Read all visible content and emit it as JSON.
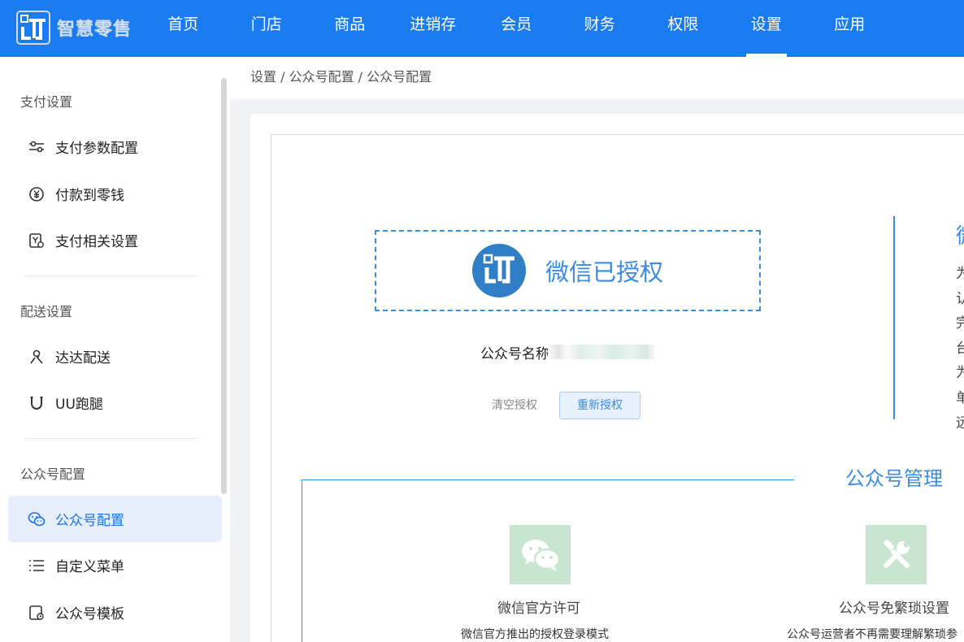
{
  "brand": {
    "name": "智慧零售"
  },
  "nav": {
    "items": [
      "首页",
      "门店",
      "商品",
      "进销存",
      "会员",
      "财务",
      "权限",
      "设置",
      "应用"
    ],
    "active_index": 7
  },
  "sidebar": {
    "groups": [
      {
        "title": "支付设置",
        "items": [
          "支付参数配置",
          "付款到零钱",
          "支付相关设置"
        ]
      },
      {
        "title": "配送设置",
        "items": [
          "达达配送",
          "UU跑腿"
        ]
      },
      {
        "title": "公众号配置",
        "items": [
          "公众号配置",
          "自定义菜单",
          "公众号模板"
        ]
      }
    ],
    "active_item": "公众号配置"
  },
  "breadcrumb": {
    "text": "设置 / 公众号配置 / 公众号配置"
  },
  "auth": {
    "status_text": "微信已授权",
    "account_label": "公众号名称",
    "clear_label": "清空授权",
    "reauth_label": "重新授权"
  },
  "right_panel": {
    "heading": "微",
    "lines": [
      "为",
      "认",
      "完",
      "台",
      "为",
      "单",
      "远"
    ]
  },
  "management": {
    "title": "公众号管理",
    "features": [
      {
        "title": "微信官方许可",
        "desc": "微信官方推出的授权登录模式"
      },
      {
        "title": "公众号免繁琐设置",
        "desc": "公众号运营者不再需要理解繁琐参"
      }
    ]
  },
  "colors": {
    "primary": "#1a7cf0",
    "accent": "#3b8be0",
    "active_bg": "#e7eefb",
    "feature_bg": "#c8e6cf"
  }
}
